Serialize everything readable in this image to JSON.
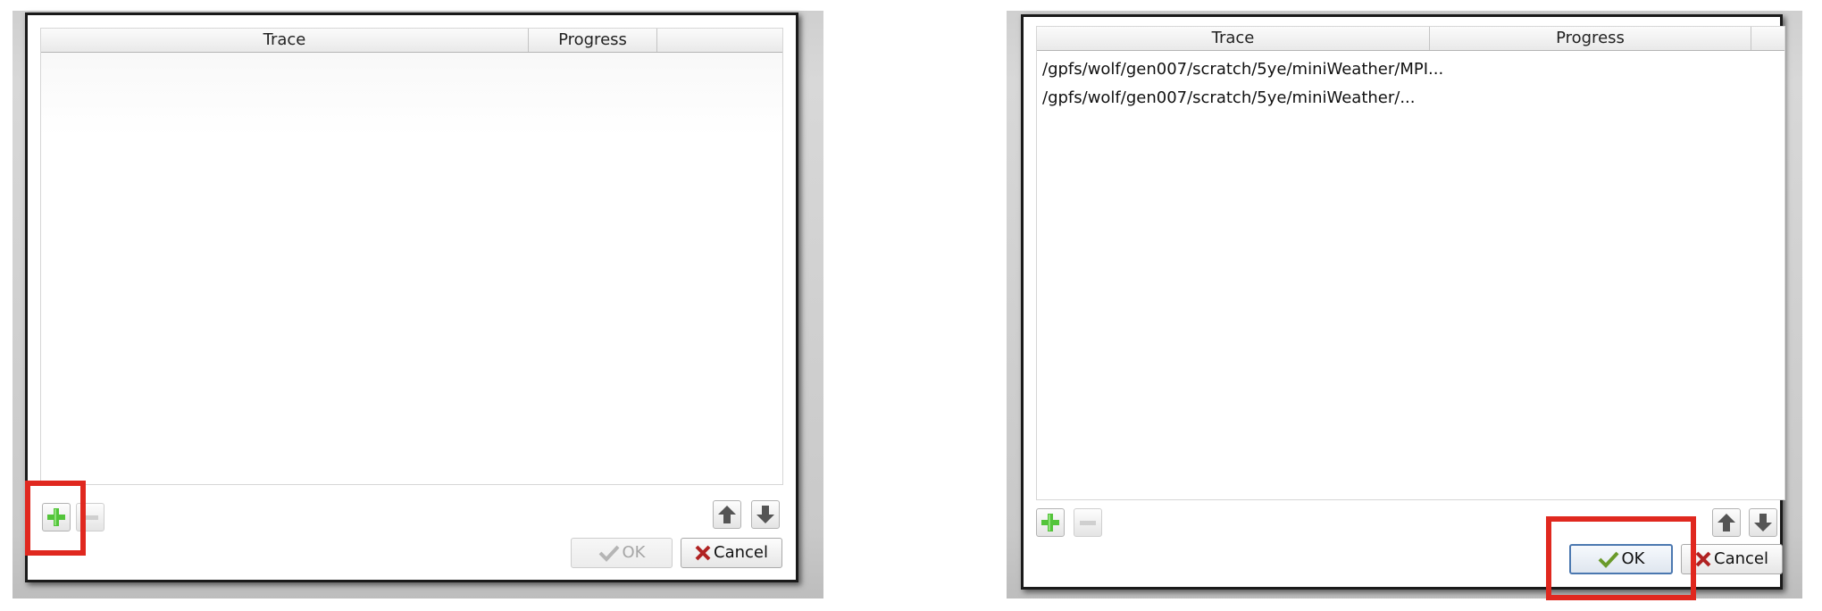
{
  "highlight_color": "#e0281f",
  "before_dialog": {
    "columns": [
      "Trace",
      "Progress"
    ],
    "rows": [],
    "buttons": {
      "add_icon": "plus-icon",
      "remove_icon": "minus-icon",
      "up_icon": "arrow-up-icon",
      "down_icon": "arrow-down-icon",
      "ok_label": "OK",
      "cancel_label": "Cancel"
    },
    "ok_enabled": false,
    "highlighted": "add-button"
  },
  "after_dialog": {
    "columns": [
      "Trace",
      "Progress"
    ],
    "rows": [
      "/gpfs/wolf/gen007/scratch/5ye/miniWeather/MPI...",
      "/gpfs/wolf/gen007/scratch/5ye/miniWeather/..."
    ],
    "buttons": {
      "add_icon": "plus-icon",
      "remove_icon": "minus-icon",
      "up_icon": "arrow-up-icon",
      "down_icon": "arrow-down-icon",
      "ok_label": "OK",
      "cancel_label": "Cancel"
    },
    "ok_enabled": true,
    "highlighted": "ok-button"
  }
}
